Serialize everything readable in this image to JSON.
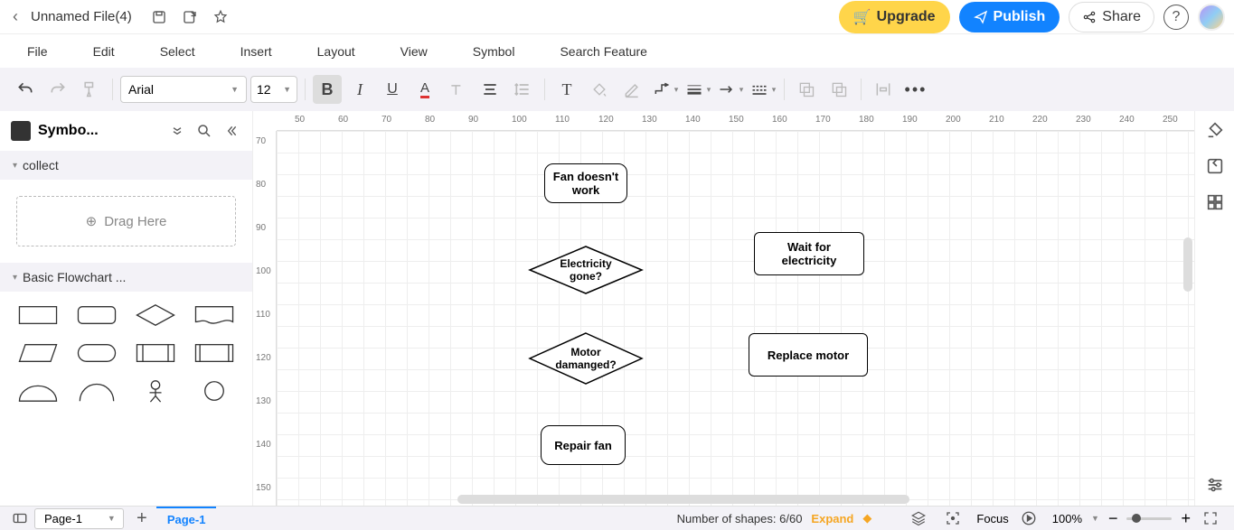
{
  "titlebar": {
    "filename": "Unnamed File(4)",
    "upgrade": "Upgrade",
    "publish": "Publish",
    "share": "Share"
  },
  "menubar": [
    "File",
    "Edit",
    "Select",
    "Insert",
    "Layout",
    "View",
    "Symbol",
    "Search Feature"
  ],
  "toolbar": {
    "font": "Arial",
    "size": "12"
  },
  "sidebar": {
    "title": "Symbo...",
    "sections": {
      "collect": "collect",
      "flowchart": "Basic Flowchart ..."
    },
    "drag_here": "Drag Here"
  },
  "ruler_h": [
    "50",
    "60",
    "70",
    "80",
    "90",
    "100",
    "110",
    "120",
    "130",
    "140",
    "150",
    "160",
    "170",
    "180",
    "190",
    "200",
    "210",
    "220",
    "230",
    "240",
    "250"
  ],
  "ruler_v": [
    "70",
    "80",
    "90",
    "100",
    "110",
    "120",
    "130",
    "140",
    "150"
  ],
  "nodes": {
    "fan": "Fan doesn't work",
    "electricity": "Electricity gone?",
    "wait": "Wait for electricity",
    "motor": "Motor damanged?",
    "replace": "Replace motor",
    "repair": "Repair fan"
  },
  "footer": {
    "page_selected": "Page-1",
    "page_tab": "Page-1",
    "shapes_info": "Number of shapes: 6/60",
    "expand": "Expand",
    "focus": "Focus",
    "zoom": "100%"
  }
}
